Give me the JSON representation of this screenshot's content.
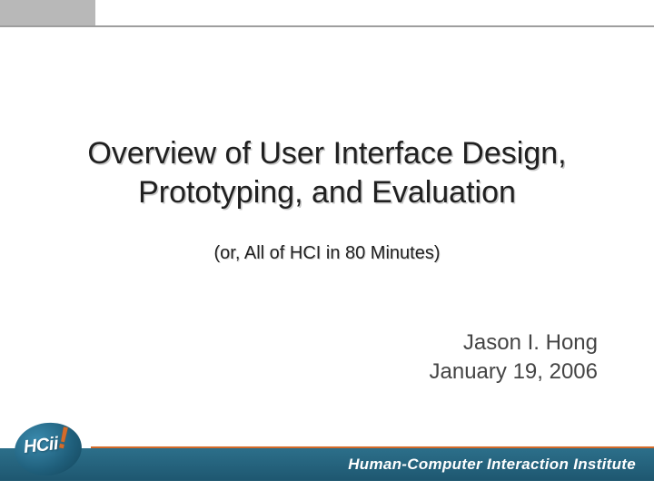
{
  "title_line1": "Overview of User Interface Design,",
  "title_line2": "Prototyping, and Evaluation",
  "subtitle": "(or, All of HCI in 80 Minutes)",
  "author": "Jason I. Hong",
  "date": "January 19, 2006",
  "footer_institute": "Human-Computer Interaction Institute",
  "logo_text": "HCii",
  "logo_bang": "!",
  "colors": {
    "footer_bg": "#1e5770",
    "accent_orange": "#d46b2a",
    "top_gray": "#b8b8b8"
  }
}
